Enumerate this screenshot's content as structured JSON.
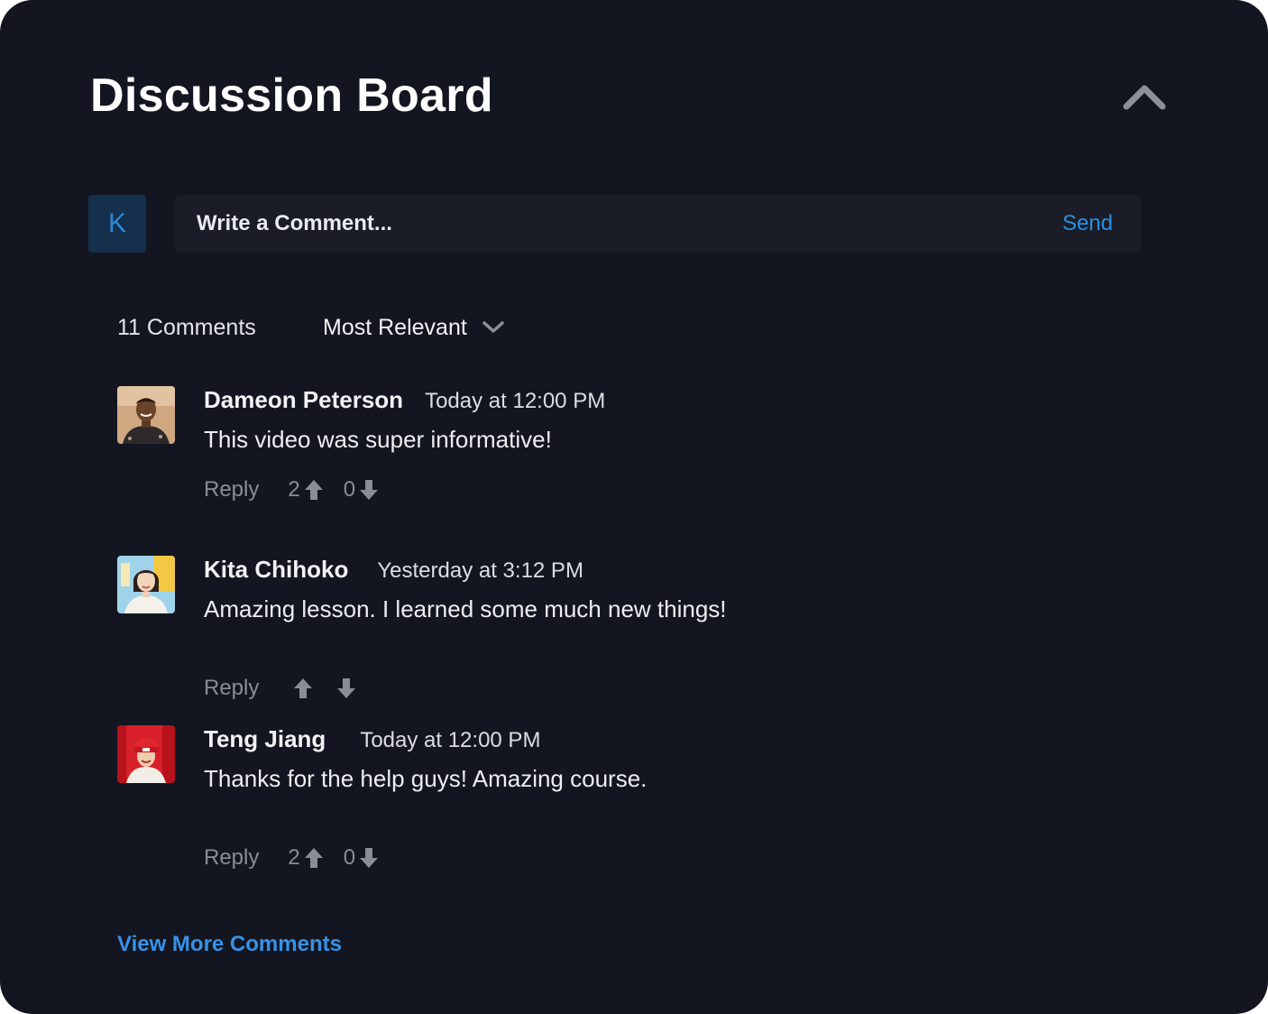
{
  "header": {
    "title": "Discussion Board",
    "collapse_icon": "chevron-up-icon"
  },
  "composer": {
    "avatar_initial": "K",
    "placeholder": "Write a Comment...",
    "send_label": "Send"
  },
  "toolbar": {
    "comment_count": "11 Comments",
    "sort_selected": "Most Relevant",
    "sort_icon": "chevron-down-icon"
  },
  "comments": [
    {
      "author": "Dameon Peterson",
      "time": "Today at 12:00 PM",
      "text": "This video was super informative!",
      "reply_label": "Reply",
      "upvotes": "2",
      "downvotes": "0"
    },
    {
      "author": "Kita Chihoko",
      "time": "Yesterday at 3:12 PM",
      "text": "Amazing lesson. I learned some much new things!",
      "reply_label": "Reply",
      "upvotes": "",
      "downvotes": ""
    },
    {
      "author": "Teng Jiang",
      "time": "Today at 12:00 PM",
      "text": "Thanks for the help guys! Amazing course.",
      "reply_label": "Reply",
      "upvotes": "2",
      "downvotes": "0"
    }
  ],
  "footer": {
    "view_more_label": "View More Comments"
  },
  "colors": {
    "background": "#131620",
    "accent": "#2a8fe0",
    "muted": "#8a8d95"
  }
}
